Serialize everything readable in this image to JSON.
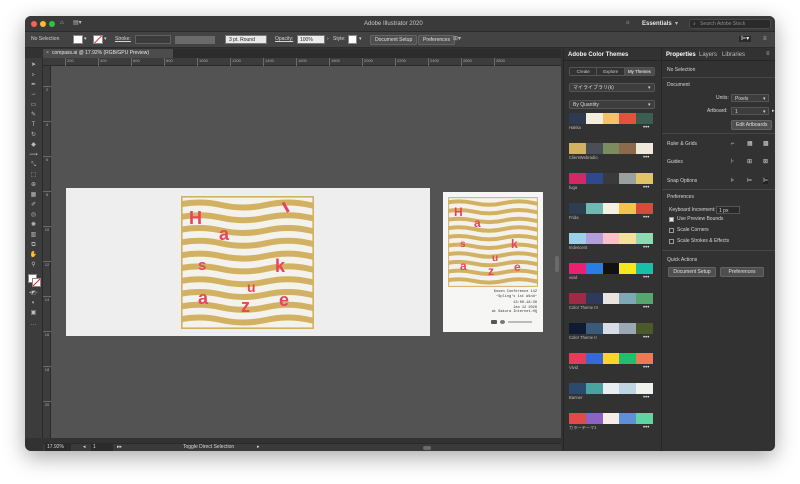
{
  "window": {
    "title": "Adobe Illustrator 2020"
  },
  "titlebar": {
    "workspace": "Essentials",
    "search_placeholder": "Search Adobe Stock"
  },
  "control_bar": {
    "selection": "No Selection",
    "stroke_label": "Stroke:",
    "brush": "3 pt. Round",
    "opacity_label": "Opacity:",
    "opacity_value": "100%",
    "style_label": "Style:",
    "doc_setup": "Document Setup",
    "preferences": "Preferences"
  },
  "document": {
    "tab_label": "compass.ai @ 17.92% (RGB/GPU Preview)",
    "ruler_ticks": [
      "200",
      "400",
      "600",
      "800",
      "1000",
      "1200",
      "1400",
      "1600",
      "1800",
      "2000",
      "2200",
      "2400",
      "2600",
      "2800"
    ],
    "vruler_ticks": [
      "2",
      "4",
      "6",
      "8",
      "10",
      "12",
      "14",
      "16",
      "18",
      "20"
    ]
  },
  "artwork": {
    "letters": [
      "H",
      "a",
      "s",
      "u",
      "k",
      "a",
      "z",
      "e"
    ],
    "small_letters": [
      "H",
      "a",
      "s",
      "u",
      "k",
      "a",
      "z",
      "e"
    ],
    "poster_lines": [
      "Kosen Conference 142",
      "~Spling's 1st Wind~",
      "13:00-18:30",
      "Jan 12 2020",
      "at Sakura Internet-HQ"
    ],
    "colors": {
      "gold": "#d2b163",
      "pink": "#e8445e",
      "paper": "#f0f0ee",
      "artboard": "#eeeeee"
    }
  },
  "status_bar": {
    "zoom": "17.92%",
    "artboard": "1",
    "hint": "Toggle Direct Selection"
  },
  "color_themes": {
    "title": "Adobe Color Themes",
    "tabs": [
      "Create",
      "Explore",
      "My Themes"
    ],
    "library": "マイライブラリ(k)",
    "sort": "By Quantity",
    "themes": [
      {
        "name": "Hakka",
        "colors": [
          "#2d3a4f",
          "#f4eedd",
          "#f5c16a",
          "#e0533e",
          "#3a5e52"
        ]
      },
      {
        "name": "ClientWebradio",
        "colors": [
          "#d2b163",
          "#4a4e56",
          "#7b8c5e",
          "#8c6a4c",
          "#efe9dc"
        ]
      },
      {
        "name": "fuga",
        "colors": [
          "#d22867",
          "#2e4a8d",
          "#3a3a3a",
          "#9aa0a0",
          "#e3c365"
        ]
      },
      {
        "name": "Frida",
        "colors": [
          "#2c3e50",
          "#6fb9b2",
          "#f5f0e1",
          "#f6c24a",
          "#d84a3a"
        ]
      },
      {
        "name": "Iridescent",
        "colors": [
          "#9ad0e8",
          "#b39ddb",
          "#f8c0c8",
          "#f5e09a",
          "#8fd9b3"
        ]
      },
      {
        "name": "vivid",
        "colors": [
          "#ec1f70",
          "#2a7de1",
          "#111111",
          "#f8e71c",
          "#17c0a6"
        ]
      },
      {
        "name": "Color Theme III",
        "colors": [
          "#9e2b45",
          "#2d3a5b",
          "#e9e4dd",
          "#7ea7b8",
          "#57a66f"
        ]
      },
      {
        "name": "Color Theme II",
        "colors": [
          "#0f1a33",
          "#3b5a78",
          "#d7dde3",
          "#9aa8b3",
          "#4a5a2d"
        ]
      },
      {
        "name": "Vivid",
        "colors": [
          "#e73b5a",
          "#3867d6",
          "#fed330",
          "#20bf6b",
          "#eb7a55"
        ]
      },
      {
        "name": "Banner",
        "colors": [
          "#2c4a6d",
          "#4aa3a0",
          "#e9eef2",
          "#c0d5e3",
          "#f0f2ee"
        ]
      },
      {
        "name": "カラーテーマ1",
        "colors": [
          "#e24a4a",
          "#8c63c4",
          "#f4eee6",
          "#5f8fd6",
          "#5fd6a2"
        ]
      }
    ]
  },
  "properties": {
    "tabs": [
      "Properties",
      "Layers",
      "Libraries"
    ],
    "selection": "No Selection",
    "document_label": "Document",
    "units_label": "Units:",
    "units_value": "Pixels",
    "artboard_label": "Artboard:",
    "artboard_value": "1",
    "edit_artboards": "Edit Artboards",
    "ruler_grids": "Ruler & Grids",
    "guides": "Guides",
    "snap_options": "Snap Options",
    "preferences": "Preferences",
    "keyboard_increment_label": "Keyboard Increment:",
    "keyboard_increment_value": "1 px",
    "use_preview_bounds": "Use Preview Bounds",
    "scale_corners": "Scale Corners",
    "scale_strokes": "Scale Strokes & Effects",
    "quick_actions": "Quick Actions",
    "doc_setup_btn": "Document Setup",
    "preferences_btn": "Preferences"
  }
}
